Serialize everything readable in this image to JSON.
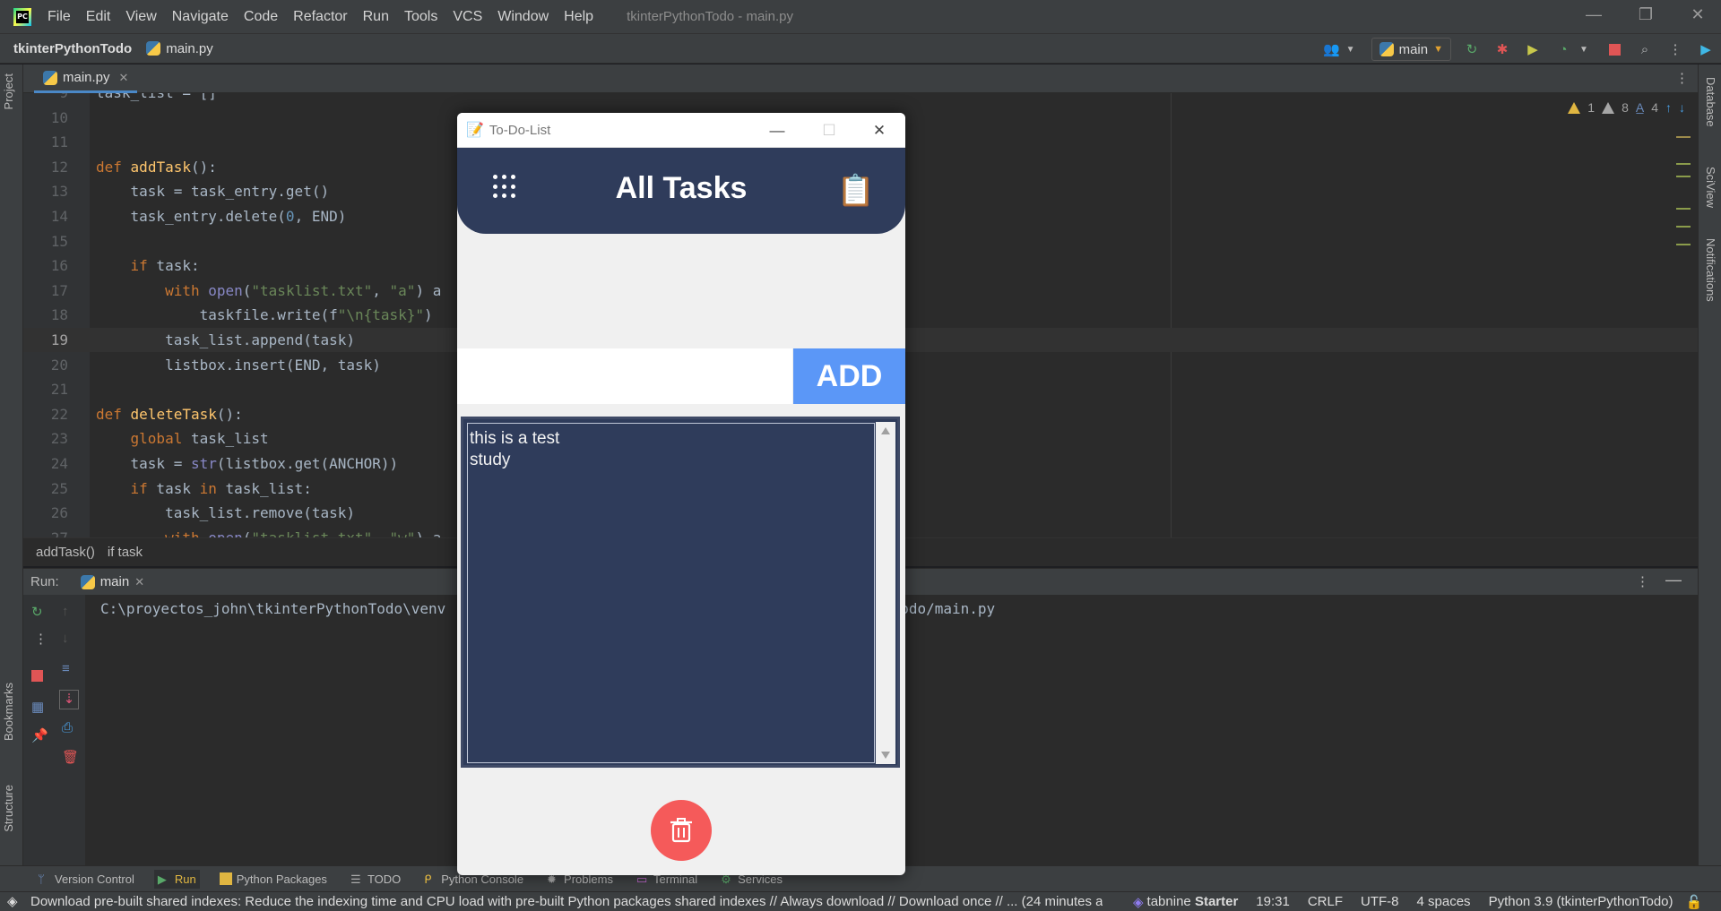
{
  "menubar": {
    "items": [
      "File",
      "Edit",
      "View",
      "Navigate",
      "Code",
      "Refactor",
      "Run",
      "Tools",
      "VCS",
      "Window",
      "Help"
    ],
    "window_title": "tkinterPythonTodo - main.py"
  },
  "navbar": {
    "project": "tkinterPythonTodo",
    "file": "main.py",
    "run_config": "main"
  },
  "left_tabs": [
    "Project",
    "Bookmarks",
    "Structure"
  ],
  "right_tabs": [
    "Database",
    "SciView",
    "Notifications"
  ],
  "editor": {
    "tab_label": "main.py",
    "inspections": {
      "warnings": "1",
      "weak_warnings": "8",
      "typos": "4"
    },
    "lines": [
      {
        "n": "9",
        "text": "task_list = []"
      },
      {
        "n": "10",
        "text": ""
      },
      {
        "n": "11",
        "text": ""
      },
      {
        "n": "12",
        "text": "def addTask():"
      },
      {
        "n": "13",
        "text": "    task = task_entry.get()"
      },
      {
        "n": "14",
        "text": "    task_entry.delete(0, END)"
      },
      {
        "n": "15",
        "text": ""
      },
      {
        "n": "16",
        "text": "    if task:"
      },
      {
        "n": "17",
        "text": "        with open(\"tasklist.txt\", \"a\") a"
      },
      {
        "n": "18",
        "text": "            taskfile.write(f\"\\n{task}\")"
      },
      {
        "n": "19",
        "text": "        task_list.append(task)"
      },
      {
        "n": "20",
        "text": "        listbox.insert(END, task)"
      },
      {
        "n": "21",
        "text": ""
      },
      {
        "n": "22",
        "text": "def deleteTask():"
      },
      {
        "n": "23",
        "text": "    global task_list"
      },
      {
        "n": "24",
        "text": "    task = str(listbox.get(ANCHOR))"
      },
      {
        "n": "25",
        "text": "    if task in task_list:"
      },
      {
        "n": "26",
        "text": "        task_list.remove(task)"
      },
      {
        "n": "27",
        "text": "        with open(\"tasklist.txt\", \"w\") a"
      }
    ],
    "current_line": "19"
  },
  "breadcrumbs": [
    "addTask()",
    "if task"
  ],
  "run_panel": {
    "label": "Run:",
    "tab": "main",
    "console_left": "C:\\proyectos_john\\tkinterPythonTodo\\venv",
    "console_right": "onTodo/main.py"
  },
  "tool_windows": [
    "Version Control",
    "Run",
    "Python Packages",
    "TODO",
    "Python Console",
    "Problems",
    "Terminal",
    "Services"
  ],
  "statusbar": {
    "message": "Download pre-built shared indexes: Reduce the indexing time and CPU load with pre-built Python packages shared indexes // Always download // Download once // ... (24 minutes a",
    "tabnine": "tabnine",
    "tabnine_plan": "Starter",
    "position": "19:31",
    "line_sep": "CRLF",
    "encoding": "UTF-8",
    "indent": "4 spaces",
    "interpreter": "Python 3.9 (tkinterPythonTodo)"
  },
  "todo_app": {
    "window_title": "To-Do-List",
    "heading": "All Tasks",
    "add_label": "ADD",
    "entry_value": "",
    "tasks": [
      "this is a test",
      "study"
    ],
    "colors": {
      "header": "#2f3c5b",
      "add": "#5b97f7",
      "delete": "#f55a5a"
    }
  }
}
